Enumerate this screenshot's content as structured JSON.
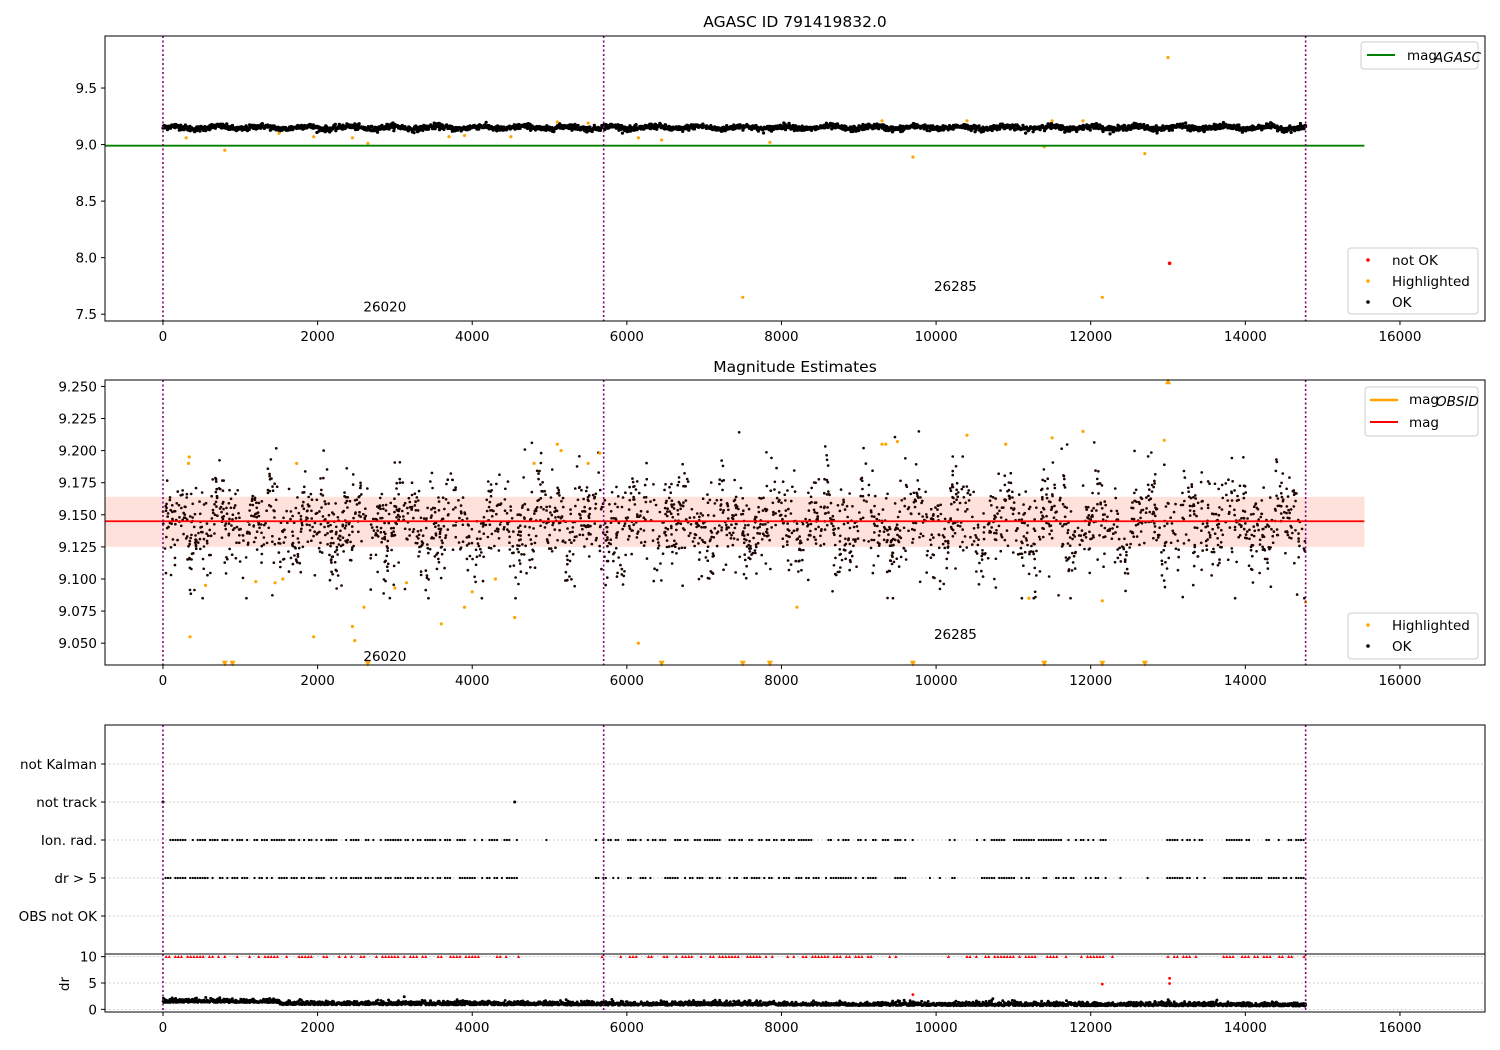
{
  "colors": {
    "ok": "#000000",
    "highlighted": "#ffa500",
    "not_ok": "#ff0000",
    "agasc_line": "#008000",
    "mag_line": "#ff0000",
    "band": "#ff9a8a",
    "obs_boundary": "#800080",
    "grid": "#b0b0b0"
  },
  "chart_data": [
    {
      "type": "scatter",
      "title": "AGASC ID 791419832.0",
      "xlim": [
        -750,
        17100
      ],
      "ylim": [
        7.44,
        9.96
      ],
      "xticks": [
        0,
        2000,
        4000,
        6000,
        8000,
        10000,
        12000,
        14000,
        16000
      ],
      "yticks": [
        7.5,
        8.0,
        8.5,
        9.0,
        9.5
      ],
      "obs_boundaries": [
        0,
        5700,
        14780
      ],
      "obs_labels": [
        {
          "text": "26020",
          "x": 2870,
          "y": 7.57
        },
        {
          "text": "26285",
          "x": 10250,
          "y": 7.75
        }
      ],
      "lines": [
        {
          "name": "mag_AGASC",
          "y": 8.99,
          "x_range": [
            -750,
            15540
          ]
        }
      ],
      "series": [
        {
          "name": "OK",
          "kind": "ok",
          "x_range": [
            0,
            14780
          ],
          "mean": 9.15,
          "amplitude": 0.025
        },
        {
          "name": "Highlighted",
          "kind": "highlighted",
          "points": [
            [
              300,
              9.06
            ],
            [
              800,
              8.95
            ],
            [
              1500,
              9.1
            ],
            [
              1950,
              9.07
            ],
            [
              2450,
              9.06
            ],
            [
              2650,
              9.01
            ],
            [
              3700,
              9.07
            ],
            [
              3900,
              9.08
            ],
            [
              4500,
              9.07
            ],
            [
              6150,
              9.06
            ],
            [
              6450,
              9.04
            ],
            [
              7500,
              7.65
            ],
            [
              7850,
              9.02
            ],
            [
              9700,
              8.89
            ],
            [
              11400,
              8.98
            ],
            [
              12150,
              7.65
            ],
            [
              12700,
              8.92
            ],
            [
              13000,
              9.77
            ],
            [
              5100,
              9.2
            ],
            [
              5500,
              9.19
            ],
            [
              9300,
              9.21
            ],
            [
              10400,
              9.21
            ],
            [
              11500,
              9.21
            ],
            [
              11900,
              9.21
            ]
          ]
        },
        {
          "name": "not OK",
          "kind": "not_ok",
          "points": [
            [
              13020,
              7.95
            ]
          ]
        }
      ],
      "legends": [
        {
          "position": "top-right",
          "entries": [
            {
              "name": "mag_AGASC",
              "base": "mag",
              "sub": "AGASC",
              "kind": "line",
              "color_key": "agasc_line"
            }
          ]
        },
        {
          "position": "lower-right",
          "entries": [
            {
              "name": "not OK",
              "kind": "dot",
              "color_key": "not_ok"
            },
            {
              "name": "Highlighted",
              "kind": "dot",
              "color_key": "highlighted"
            },
            {
              "name": "OK",
              "kind": "dot",
              "color_key": "ok"
            }
          ]
        }
      ]
    },
    {
      "type": "scatter",
      "title": "Magnitude Estimates",
      "xlim": [
        -750,
        17100
      ],
      "ylim": [
        9.033,
        9.255
      ],
      "xticks": [
        0,
        2000,
        4000,
        6000,
        8000,
        10000,
        12000,
        14000,
        16000
      ],
      "yticks": [
        9.05,
        9.075,
        9.1,
        9.125,
        9.15,
        9.175,
        9.2,
        9.225,
        9.25
      ],
      "obs_boundaries": [
        0,
        5700,
        14780
      ],
      "obs_labels": [
        {
          "text": "26020",
          "x": 2870,
          "y": 9.04
        },
        {
          "text": "26285",
          "x": 10250,
          "y": 9.057
        }
      ],
      "band": {
        "y_range": [
          9.125,
          9.164
        ],
        "x_range": [
          -750,
          15540
        ]
      },
      "lines": [
        {
          "name": "mag",
          "y": 9.145,
          "x_range": [
            -750,
            15540
          ]
        }
      ],
      "series": [
        {
          "name": "OK",
          "kind": "ok",
          "x_range": [
            0,
            14780
          ],
          "mean": 9.142,
          "amplitude": 0.035
        },
        {
          "name": "Highlighted",
          "kind": "highlighted",
          "points": [
            [
              330,
              9.19
            ],
            [
              340,
              9.195
            ],
            [
              350,
              9.055
            ],
            [
              550,
              9.095
            ],
            [
              1200,
              9.098
            ],
            [
              1450,
              9.097
            ],
            [
              1550,
              9.1
            ],
            [
              1730,
              9.19
            ],
            [
              1950,
              9.055
            ],
            [
              2450,
              9.063
            ],
            [
              2480,
              9.052
            ],
            [
              2600,
              9.078
            ],
            [
              3000,
              9.093
            ],
            [
              3150,
              9.097
            ],
            [
              3600,
              9.065
            ],
            [
              3900,
              9.078
            ],
            [
              4000,
              9.09
            ],
            [
              4300,
              9.1
            ],
            [
              4550,
              9.07
            ],
            [
              4800,
              9.19
            ],
            [
              5100,
              9.205
            ],
            [
              5150,
              9.2
            ],
            [
              5500,
              9.19
            ],
            [
              5650,
              9.198
            ],
            [
              6150,
              9.05
            ],
            [
              8200,
              9.078
            ],
            [
              9300,
              9.205
            ],
            [
              9350,
              9.205
            ],
            [
              9500,
              9.207
            ],
            [
              10400,
              9.212
            ],
            [
              10900,
              9.205
            ],
            [
              11200,
              9.085
            ],
            [
              11500,
              9.21
            ],
            [
              11900,
              9.215
            ],
            [
              12150,
              9.083
            ],
            [
              12950,
              9.208
            ],
            [
              14780,
              9.082
            ]
          ]
        },
        {
          "name": "Highlighted (clipped)",
          "kind": "highlighted_clip",
          "points": [
            [
              800,
              9.034
            ],
            [
              900,
              9.034
            ],
            [
              2650,
              9.034
            ],
            [
              6450,
              9.034
            ],
            [
              7500,
              9.034
            ],
            [
              7850,
              9.034
            ],
            [
              9700,
              9.034
            ],
            [
              11400,
              9.034
            ],
            [
              12150,
              9.034
            ],
            [
              12700,
              9.034
            ],
            [
              13000,
              9.254
            ]
          ]
        }
      ],
      "legends": [
        {
          "position": "top-right",
          "entries": [
            {
              "name": "mag_OBSID",
              "base": "mag",
              "sub": "OBSID",
              "kind": "line",
              "color_key": "highlighted"
            },
            {
              "name": "mag",
              "kind": "line",
              "color_key": "mag_line"
            }
          ]
        },
        {
          "position": "lower-right",
          "entries": [
            {
              "name": "Highlighted",
              "kind": "dot",
              "color_key": "highlighted"
            },
            {
              "name": "OK",
              "kind": "dot",
              "color_key": "ok"
            }
          ]
        }
      ]
    },
    {
      "type": "scatter",
      "title": "",
      "xlim": [
        -750,
        17100
      ],
      "categories": [
        "not Kalman",
        "not track",
        "Ion. rad.",
        "dr > 5",
        "OBS not OK"
      ],
      "obs_boundaries": [
        0,
        5700,
        14780
      ],
      "series": [
        {
          "name": "not track",
          "category": "not track",
          "points": [
            0,
            4550
          ]
        },
        {
          "name": "Ion. rad.",
          "category": "Ion. rad.",
          "kind": "flag_density",
          "x_range": [
            0,
            14780
          ]
        },
        {
          "name": "dr > 5",
          "category": "dr > 5",
          "kind": "flag_density",
          "x_range": [
            0,
            14780
          ]
        }
      ]
    },
    {
      "type": "scatter",
      "title": "",
      "ylabel": "dr",
      "xlim": [
        -750,
        17100
      ],
      "ylim": [
        -0.5,
        10.5
      ],
      "xticks": [
        0,
        2000,
        4000,
        6000,
        8000,
        10000,
        12000,
        14000,
        16000
      ],
      "yticks": [
        0,
        5,
        10
      ],
      "obs_boundaries": [
        0,
        5700,
        14780
      ],
      "series": [
        {
          "name": "dr",
          "kind": "ok",
          "x_range": [
            0,
            14780
          ],
          "mean": 0.9,
          "amplitude": 0.5
        },
        {
          "name": "dr clipped",
          "kind": "not_ok_clip",
          "y": 10
        },
        {
          "name": "dr outliers",
          "kind": "not_ok",
          "points": [
            [
              9700,
              2.8
            ],
            [
              12150,
              4.8
            ],
            [
              13020,
              4.9
            ],
            [
              13020,
              5.9
            ]
          ]
        }
      ]
    }
  ]
}
